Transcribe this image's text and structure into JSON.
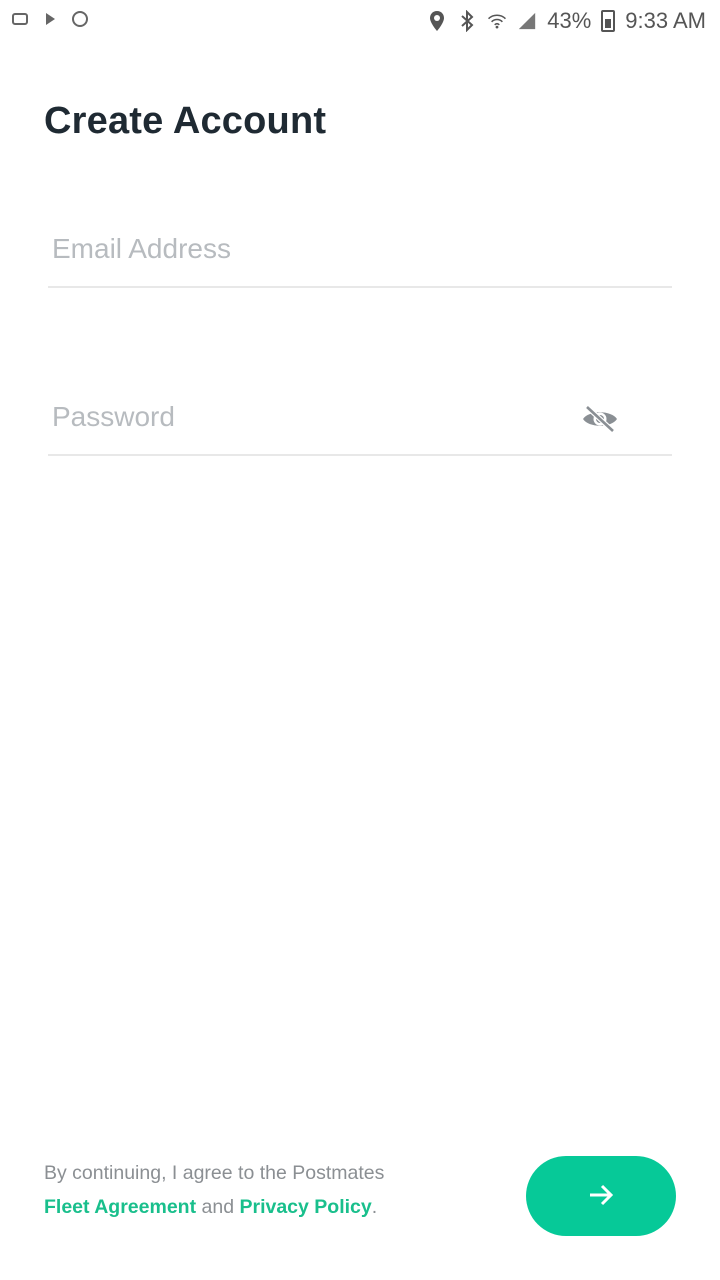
{
  "status_bar": {
    "battery": "43%",
    "time": "9:33 AM"
  },
  "screen": {
    "title": "Create Account"
  },
  "form": {
    "email": {
      "placeholder": "Email Address",
      "value": ""
    },
    "password": {
      "placeholder": "Password",
      "value": ""
    }
  },
  "footer": {
    "terms_prefix": "By continuing, I agree to the Postmates",
    "fleet_link": "Fleet Agreement",
    "and_text": "and",
    "privacy_link": "Privacy Policy",
    "period": "."
  },
  "colors": {
    "accent": "#06c998",
    "link": "#19bf8c",
    "title": "#1f2a33",
    "placeholder": "#b7bbbf"
  },
  "icons": {
    "next_button": "arrow-right-icon",
    "password_toggle": "eye-off-icon"
  }
}
